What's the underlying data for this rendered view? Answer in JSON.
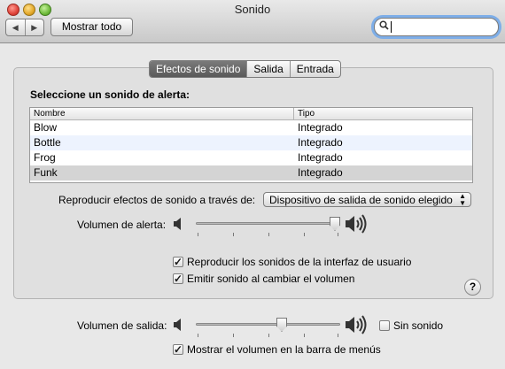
{
  "window": {
    "title": "Sonido"
  },
  "toolbar": {
    "back_icon": "◀",
    "forward_icon": "▶",
    "show_all_label": "Mostrar todo",
    "search_value": "",
    "search_placeholder": ""
  },
  "tabs": [
    {
      "label": "Efectos de sonido",
      "active": true
    },
    {
      "label": "Salida"
    },
    {
      "label": "Entrada"
    }
  ],
  "effects": {
    "heading": "Seleccione un sonido de alerta:",
    "columns": {
      "name": "Nombre",
      "type": "Tipo"
    },
    "rows": [
      {
        "name": "Blow",
        "type": "Integrado"
      },
      {
        "name": "Bottle",
        "type": "Integrado"
      },
      {
        "name": "Frog",
        "type": "Integrado"
      },
      {
        "name": "Funk",
        "type": "Integrado",
        "selected": true
      }
    ],
    "play_through_label": "Reproducir efectos de sonido a través de:",
    "play_through_value": "Dispositivo de salida de sonido elegido",
    "alert_volume_label": "Volumen de alerta:",
    "alert_volume": 1.0,
    "ui_sounds_label": "Reproducir los sonidos de la interfaz de usuario",
    "ui_sounds_checked": true,
    "volume_feedback_label": "Emitir sonido al cambiar el volumen",
    "volume_feedback_checked": true,
    "help_label": "?"
  },
  "output": {
    "volume_label": "Volumen de salida:",
    "volume": 0.6,
    "mute_label": "Sin sonido",
    "mute_checked": false,
    "menu_bar_label": "Mostrar el volumen en la barra de menús",
    "menu_bar_checked": true
  }
}
